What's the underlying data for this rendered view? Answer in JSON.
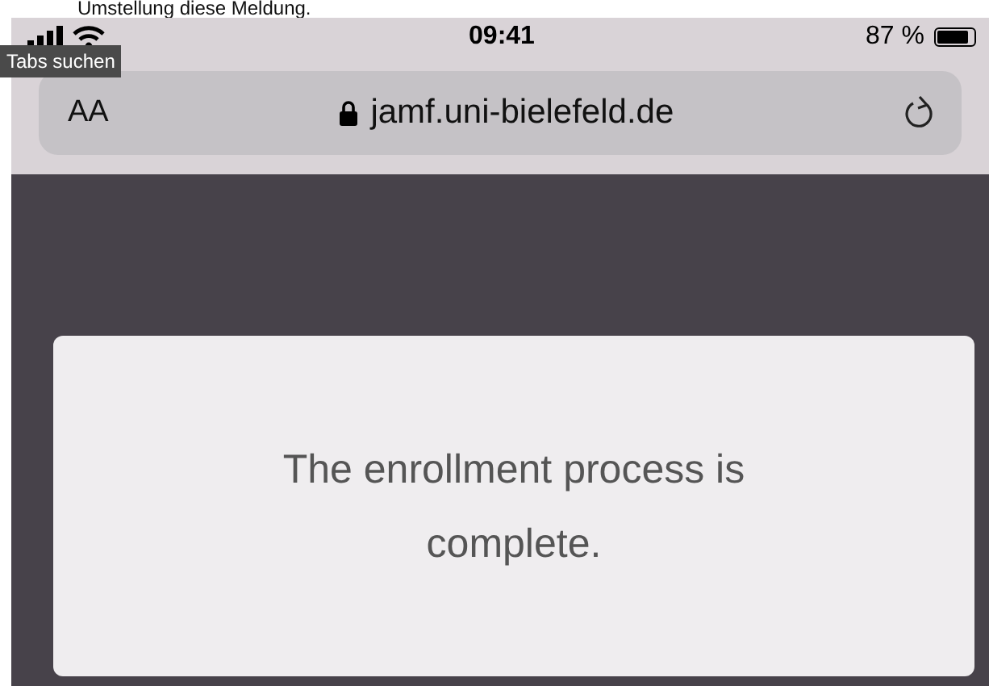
{
  "caption": "Umstellung diese Meldung.",
  "status_bar": {
    "time": "09:41",
    "battery": "87 %",
    "battery_meter": {
      "level": 0.87
    }
  },
  "tooltip": "Tabs suchen",
  "address_bar": {
    "text_size_button": "AA",
    "url": "jamf.uni-bielefeld.de"
  },
  "message": "The enrollment process is complete."
}
